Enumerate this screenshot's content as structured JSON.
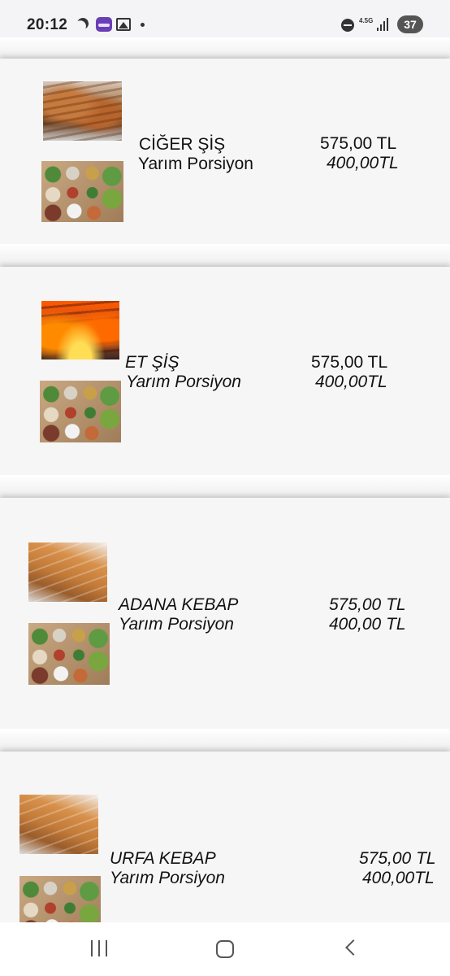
{
  "status_bar": {
    "time": "20:12",
    "left_icons": [
      "moon-icon",
      "app-badge-icon",
      "image-icon",
      "dot-icon"
    ],
    "network_label": "4.5G",
    "battery_level": "37"
  },
  "menu": {
    "items": [
      {
        "name": "CİĞER ŞİŞ",
        "portion_label": "Yarım Porsiyon",
        "full_price": "575,00 TL",
        "half_price": "400,00TL",
        "image_main": "grilled-liver-skewers",
        "image_side": "mezze-platter"
      },
      {
        "name": "ET ŞİŞ",
        "portion_label": "Yarım Porsiyon",
        "full_price": "575,00 TL",
        "half_price": "400,00TL",
        "image_main": "meat-skewers-on-fire",
        "image_side": "mezze-platter"
      },
      {
        "name": "ADANA KEBAP",
        "portion_label": "Yarım Porsiyon",
        "full_price": "575,00 TL",
        "half_price": "400,00 TL",
        "image_main": "adana-kebab-skewers",
        "image_side": "mezze-platter"
      },
      {
        "name": "URFA KEBAP",
        "portion_label": "Yarım Porsiyon",
        "full_price": "575,00 TL",
        "half_price": "400,00TL",
        "image_main": "urfa-kebab-skewers",
        "image_side": "mezze-platter"
      }
    ]
  },
  "nav_bar": {
    "icons": [
      "recents-icon",
      "home-icon",
      "back-icon"
    ]
  }
}
